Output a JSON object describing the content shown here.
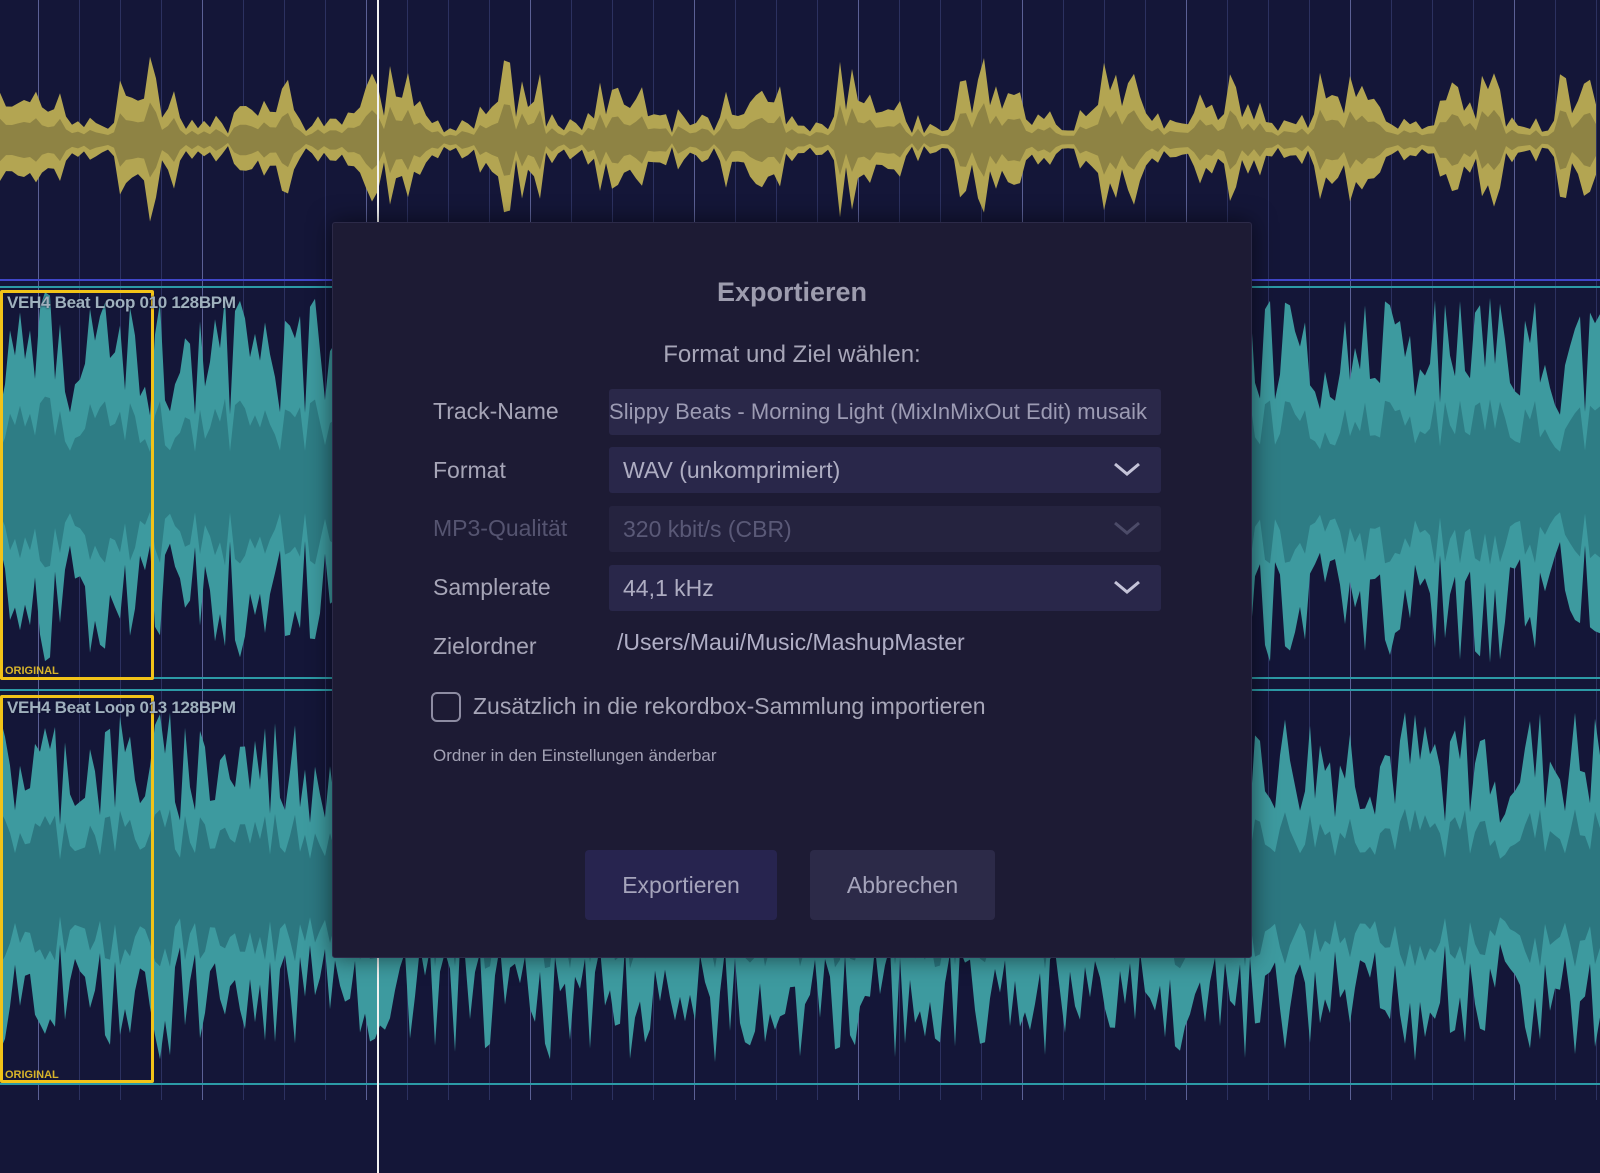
{
  "tracks": [
    {
      "clip_label": "VEH4 Beat Loop 010 128BPM",
      "tag": "ORIGINAL"
    },
    {
      "clip_label": "VEH4 Beat Loop 013 128BPM",
      "tag": "ORIGINAL"
    }
  ],
  "colors": {
    "background": "#141638",
    "master_waveform": "#b3a552",
    "track_waveform": "#3d9a9f",
    "loop_highlight": "#f2c318",
    "dialog_bg": "#1d1b34"
  },
  "dialog": {
    "title": "Exportieren",
    "subtitle": "Format und Ziel wählen:",
    "track_name": {
      "label": "Track-Name",
      "value": "Slippy Beats - Morning Light  (MixInMixOut Edit) musaik"
    },
    "format": {
      "label": "Format",
      "value": "WAV (unkomprimiert)",
      "icon": "chevron-down-icon"
    },
    "mp3_quality": {
      "label": "MP3-Qualität",
      "value": "320 kbit/s (CBR)",
      "disabled": true,
      "icon": "chevron-down-icon"
    },
    "samplerate": {
      "label": "Samplerate",
      "value": "44,1 kHz",
      "icon": "chevron-down-icon"
    },
    "destination": {
      "label": "Zielordner",
      "value": "/Users/Maui/Music/MashupMaster"
    },
    "import_option": {
      "label": "Zusätzlich in die rekordbox-Sammlung importieren",
      "checked": false
    },
    "hint": "Ordner in den Einstellungen änderbar",
    "buttons": {
      "export": "Exportieren",
      "cancel": "Abbrechen"
    }
  }
}
